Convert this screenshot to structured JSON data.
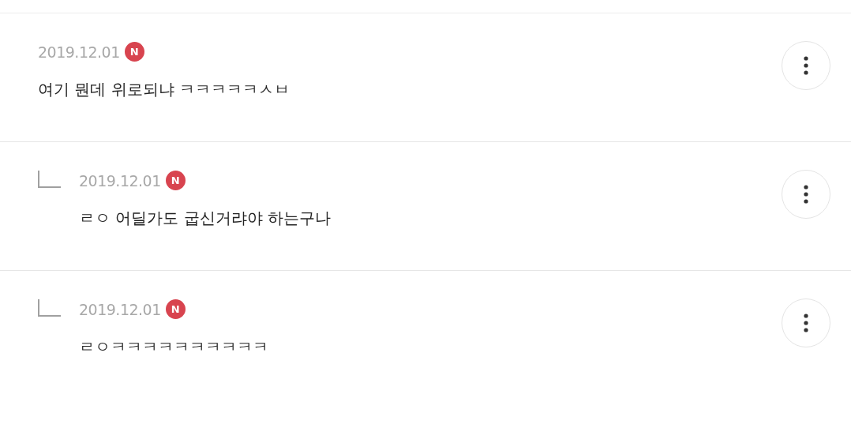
{
  "comments": [
    {
      "kind": "comment",
      "date": "2019.12.01",
      "badge": "N",
      "text": "여기 뭔데 위로되냐 ㅋㅋㅋㅋㅋㅅㅂ"
    },
    {
      "kind": "reply",
      "date": "2019.12.01",
      "badge": "N",
      "text": "ㄹㅇ 어딜가도 굽신거랴야 하는구나"
    },
    {
      "kind": "reply",
      "date": "2019.12.01",
      "badge": "N",
      "text": "ㄹㅇㅋㅋㅋㅋㅋㅋㅋㅋㅋㅋ"
    }
  ]
}
